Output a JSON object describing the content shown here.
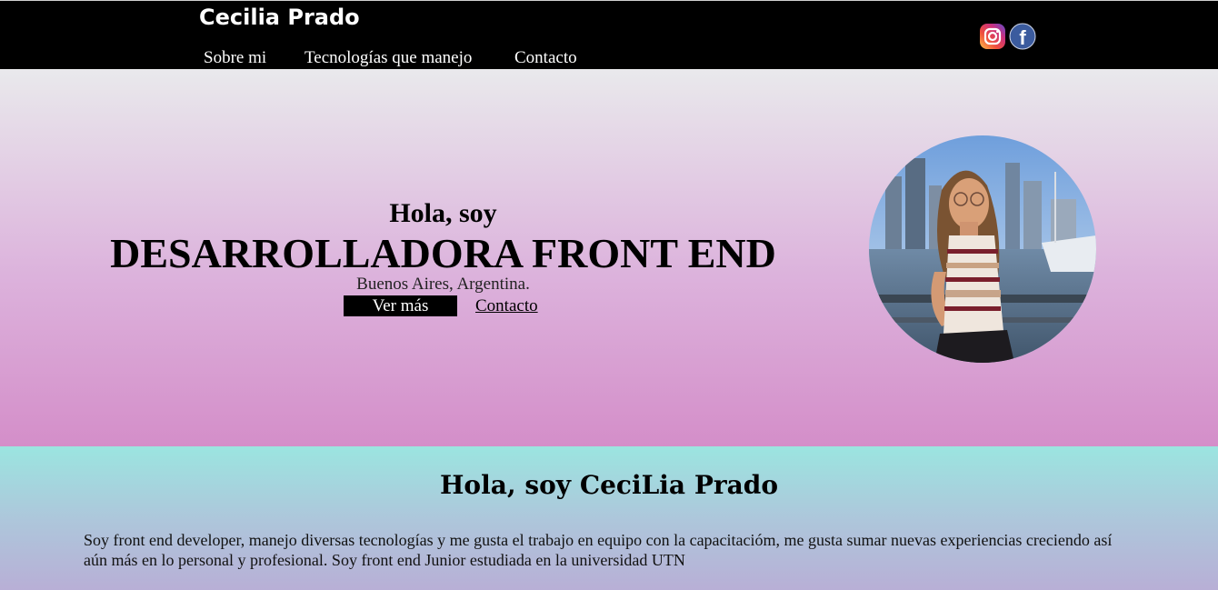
{
  "header": {
    "brand": "Cecilia Prado",
    "nav": {
      "about": "Sobre mi",
      "technologies": "Tecnologías que manejo",
      "contact": "Contacto"
    },
    "social": [
      "instagram-icon",
      "facebook-icon"
    ],
    "facebook_glyph": "f"
  },
  "hero": {
    "greeting": "Hola, soy",
    "title": "DESARROLLADORA FRONT END",
    "location": "Buenos Aires, Argentina.",
    "primary_button": "Ver más",
    "secondary_link": "Contacto"
  },
  "about": {
    "heading": "Hola, soy CeciLia Prado",
    "text": "Soy front end developer, manejo diversas tecnologías y me gusta el trabajo en equipo con la capacitacióm, me gusta sumar nuevas experiencias creciendo así aún más en lo personal y profesional. Soy front end Junior estudiada en la universidad UTN"
  },
  "colors": {
    "nav_bg": "#000000",
    "hero_gradient": [
      "#e9e9ec",
      "#dcb2dc",
      "#d48ec9"
    ],
    "about_gradient": [
      "#9be5e0",
      "#adc7db",
      "#b8afd6"
    ],
    "button_bg": "#000000"
  }
}
